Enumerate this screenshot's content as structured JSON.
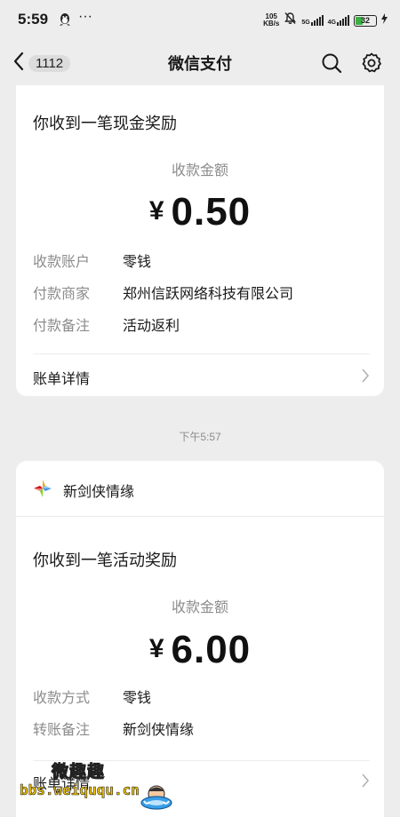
{
  "status_bar": {
    "time": "5:59",
    "dots": "···",
    "net_speed_value": "105",
    "net_speed_unit": "KB/s",
    "signal1_label": "5G",
    "signal2_label": "4G",
    "battery_level": "32"
  },
  "nav": {
    "back_count": "1112",
    "title": "微信支付"
  },
  "card1": {
    "title": "你收到一笔现金奖励",
    "amount_label": "收款金额",
    "currency": "¥",
    "amount": "0.50",
    "rows": [
      {
        "label": "收款账户",
        "value": "零钱"
      },
      {
        "label": "付款商家",
        "value": "郑州信跃网络科技有限公司"
      },
      {
        "label": "付款备注",
        "value": "活动返利"
      }
    ],
    "detail_label": "账单详情"
  },
  "timestamp": "下午5:57",
  "card2": {
    "brand_name": "新剑侠情缘",
    "title": "你收到一笔活动奖励",
    "amount_label": "收款金额",
    "currency": "¥",
    "amount": "6.00",
    "rows": [
      {
        "label": "收款方式",
        "value": "零钱"
      },
      {
        "label": "转账备注",
        "value": "新剑侠情缘"
      }
    ],
    "detail_label": "账单详情"
  },
  "watermark": {
    "top": "微趣趣",
    "bottom": "bbs.weiququ.cn"
  },
  "colors": {
    "background": "#ededed",
    "card": "#ffffff",
    "label_gray": "#8c8c8c",
    "battery_green": "#3cb043"
  }
}
